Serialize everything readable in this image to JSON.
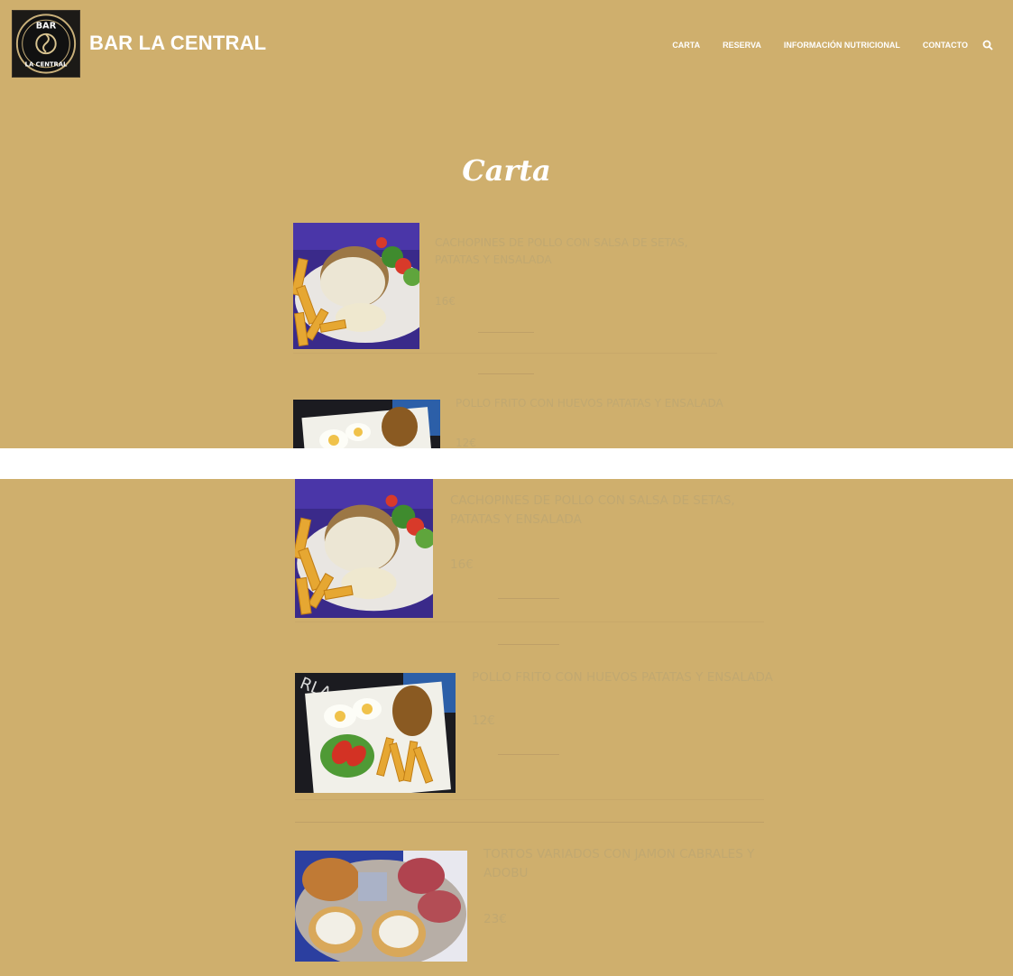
{
  "site": {
    "brand": "BAR LA CENTRAL",
    "logo_text_top": "BAR",
    "logo_text_bottom": "LA CENTRAL"
  },
  "nav": {
    "items": [
      "CARTA",
      "RESERVA",
      "INFORMACIÓN NUTRICIONAL",
      "CONTACTO"
    ],
    "search_icon": "search-icon"
  },
  "page": {
    "title": "Carta"
  },
  "menu": [
    {
      "title_line1": "CACHOPINES DE POLLO CON SALSA DE SETAS,",
      "title_line2": "PATATAS Y ENSALADA",
      "price": "16€"
    },
    {
      "title_line1": "POLLO FRITO CON HUEVOS PATATAS Y ENSALADA",
      "title_line2": "",
      "price": "12€"
    },
    {
      "title_line1": "TORTOS VARIADOS CON JAMON CABRALES Y",
      "title_line2": "ADOBU",
      "price": "23€"
    }
  ],
  "colors": {
    "background": "#cfaf6d",
    "text_faded": "#c1a870",
    "white": "#ffffff"
  }
}
